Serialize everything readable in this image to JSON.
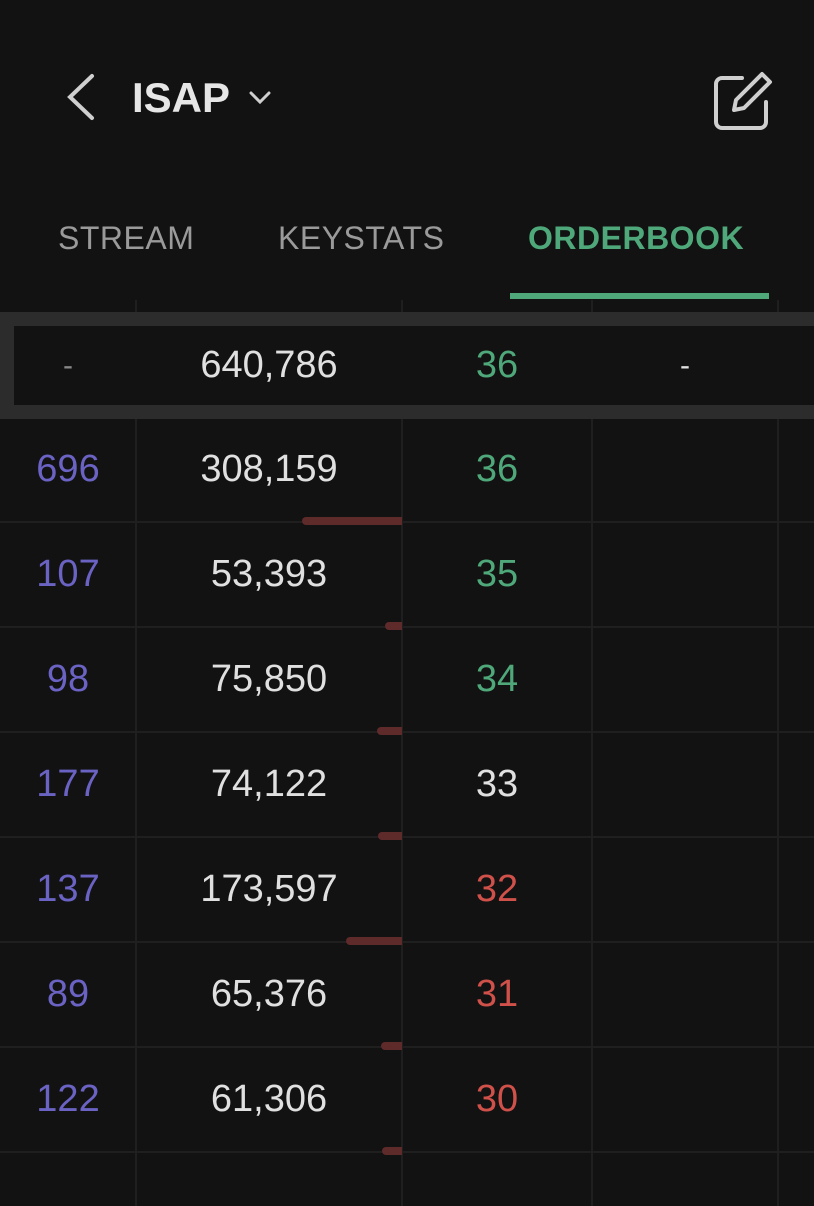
{
  "header": {
    "title": "ISAP",
    "back_icon": "chevron-left-icon",
    "dropdown_icon": "chevron-down-icon",
    "edit_icon": "edit-icon"
  },
  "tabs": [
    {
      "label": "STREAM",
      "active": false
    },
    {
      "label": "KEYSTATS",
      "active": false
    },
    {
      "label": "ORDERBOOK",
      "active": true
    }
  ],
  "colors": {
    "background": "#121212",
    "accent": "#4fa87a",
    "orders": "#6b63c4",
    "up": "#4fa87a",
    "down": "#d0504a",
    "neutral": "#e0e0e0",
    "volume_bar": "#5e2a2a"
  },
  "summary": {
    "orders": "-",
    "volume": "640,786",
    "price": "36",
    "offer": "-"
  },
  "bids": [
    {
      "orders": "696",
      "volume": "308,159",
      "price": "36",
      "dir": "up",
      "vol": 308159
    },
    {
      "orders": "107",
      "volume": "53,393",
      "price": "35",
      "dir": "up",
      "vol": 53393
    },
    {
      "orders": "98",
      "volume": "75,850",
      "price": "34",
      "dir": "up",
      "vol": 75850
    },
    {
      "orders": "177",
      "volume": "74,122",
      "price": "33",
      "dir": "neutral",
      "vol": 74122
    },
    {
      "orders": "137",
      "volume": "173,597",
      "price": "32",
      "dir": "down",
      "vol": 173597
    },
    {
      "orders": "89",
      "volume": "65,376",
      "price": "31",
      "dir": "down",
      "vol": 65376
    },
    {
      "orders": "122",
      "volume": "61,306",
      "price": "30",
      "dir": "down",
      "vol": 61306
    }
  ]
}
